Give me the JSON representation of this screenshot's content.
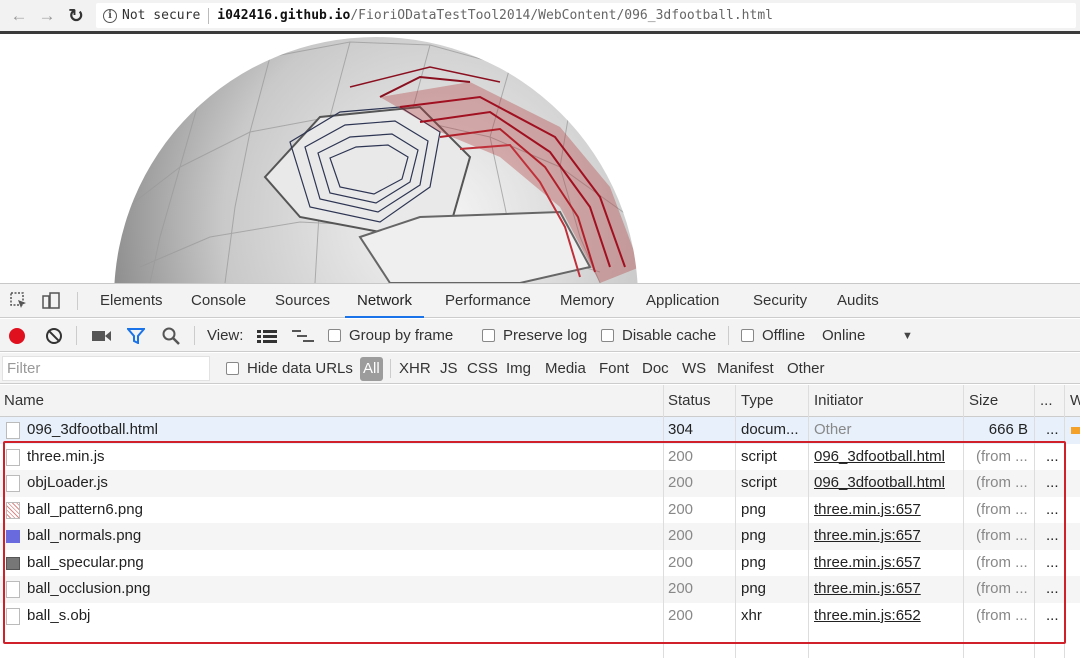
{
  "browser": {
    "security_label": "Not secure",
    "url_host": "i042416.github.io",
    "url_path": "/FioriODataTestTool2014/WebContent/096_3dfootball.html"
  },
  "devtools": {
    "tabs": [
      "Elements",
      "Console",
      "Sources",
      "Network",
      "Performance",
      "Memory",
      "Application",
      "Security",
      "Audits"
    ],
    "active_tab": "Network",
    "toolbar": {
      "view_label": "View:",
      "group_by_frame": "Group by frame",
      "preserve_log": "Preserve log",
      "disable_cache": "Disable cache",
      "offline": "Offline",
      "throttle": "Online"
    },
    "filter": {
      "placeholder": "Filter",
      "hide_data_urls": "Hide data URLs",
      "types": [
        "All",
        "XHR",
        "JS",
        "CSS",
        "Img",
        "Media",
        "Font",
        "Doc",
        "WS",
        "Manifest",
        "Other"
      ],
      "active_type": "All"
    },
    "table": {
      "columns": [
        "Name",
        "Status",
        "Type",
        "Initiator",
        "Size",
        "...",
        "W"
      ],
      "rows": [
        {
          "name": "096_3dfootball.html",
          "status": "304",
          "type": "docum...",
          "initiator": "Other",
          "size": "666 B",
          "more": "..."
        },
        {
          "name": "three.min.js",
          "status": "200",
          "type": "script",
          "initiator": "096_3dfootball.html",
          "size": "(from ...",
          "more": "..."
        },
        {
          "name": "objLoader.js",
          "status": "200",
          "type": "script",
          "initiator": "096_3dfootball.html",
          "size": "(from ...",
          "more": "..."
        },
        {
          "name": "ball_pattern6.png",
          "status": "200",
          "type": "png",
          "initiator": "three.min.js:657",
          "size": "(from ...",
          "more": "..."
        },
        {
          "name": "ball_normals.png",
          "status": "200",
          "type": "png",
          "initiator": "three.min.js:657",
          "size": "(from ...",
          "more": "..."
        },
        {
          "name": "ball_specular.png",
          "status": "200",
          "type": "png",
          "initiator": "three.min.js:657",
          "size": "(from ...",
          "more": "..."
        },
        {
          "name": "ball_occlusion.png",
          "status": "200",
          "type": "png",
          "initiator": "three.min.js:657",
          "size": "(from ...",
          "more": "..."
        },
        {
          "name": "ball_s.obj",
          "status": "200",
          "type": "xhr",
          "initiator": "three.min.js:652",
          "size": "(from ...",
          "more": "..."
        }
      ]
    }
  },
  "colors": {
    "record": "#e0101f",
    "highlight_border": "#d0202a",
    "active_tab_underline": "#1a73e8"
  }
}
